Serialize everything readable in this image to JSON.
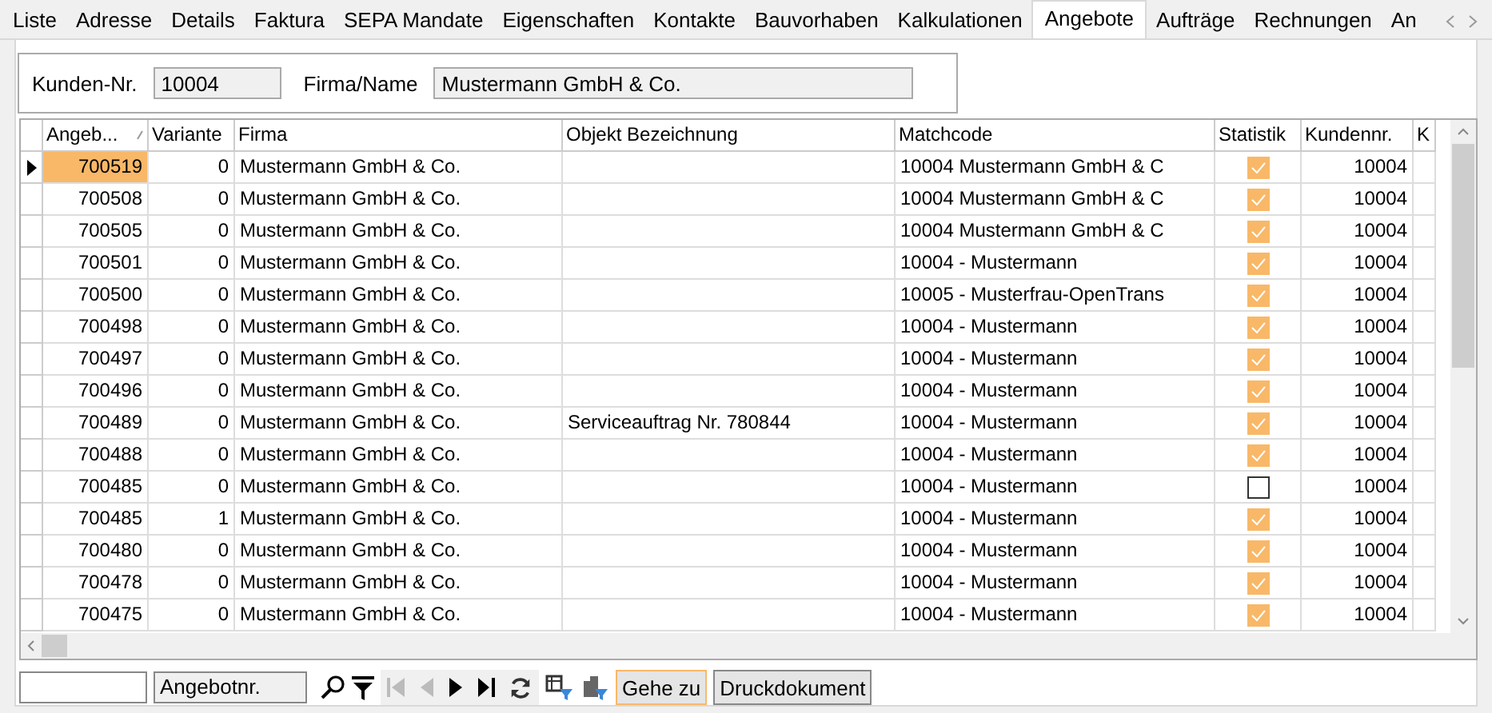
{
  "tabs": [
    {
      "label": "Liste",
      "selected": false
    },
    {
      "label": "Adresse",
      "selected": false
    },
    {
      "label": "Details",
      "selected": false
    },
    {
      "label": "Faktura",
      "selected": false
    },
    {
      "label": "SEPA Mandate",
      "selected": false
    },
    {
      "label": "Eigenschaften",
      "selected": false
    },
    {
      "label": "Kontakte",
      "selected": false
    },
    {
      "label": "Bauvorhaben",
      "selected": false
    },
    {
      "label": "Kalkulationen",
      "selected": false
    },
    {
      "label": "Angebote",
      "selected": true
    },
    {
      "label": "Aufträge",
      "selected": false
    },
    {
      "label": "Rechnungen",
      "selected": false
    },
    {
      "label": "An",
      "selected": false
    }
  ],
  "customer": {
    "number_label": "Kunden-Nr.",
    "number": "10004",
    "name_label": "Firma/Name",
    "name": "Mustermann GmbH & Co."
  },
  "table": {
    "columns": [
      "Angeb...",
      "Variante",
      "Firma",
      "Objekt Bezeichnung",
      "Matchcode",
      "Statistik",
      "Kundennr.",
      "K"
    ],
    "rows": [
      {
        "selected": true,
        "cells": [
          "700519",
          "0",
          "Mustermann GmbH & Co.",
          "",
          "10004 Mustermann GmbH & C"
        ],
        "statistik": true,
        "kundennr": "10004"
      },
      {
        "selected": false,
        "cells": [
          "700508",
          "0",
          "Mustermann GmbH & Co.",
          "",
          "10004 Mustermann GmbH & C"
        ],
        "statistik": true,
        "kundennr": "10004"
      },
      {
        "selected": false,
        "cells": [
          "700505",
          "0",
          "Mustermann GmbH & Co.",
          "",
          "10004 Mustermann GmbH & C"
        ],
        "statistik": true,
        "kundennr": "10004"
      },
      {
        "selected": false,
        "cells": [
          "700501",
          "0",
          "Mustermann GmbH & Co.",
          "",
          "10004 - Mustermann"
        ],
        "statistik": true,
        "kundennr": "10004"
      },
      {
        "selected": false,
        "cells": [
          "700500",
          "0",
          "Mustermann GmbH & Co.",
          "",
          "10005 - Musterfrau-OpenTrans"
        ],
        "statistik": true,
        "kundennr": "10004"
      },
      {
        "selected": false,
        "cells": [
          "700498",
          "0",
          "Mustermann GmbH & Co.",
          "",
          "10004 - Mustermann"
        ],
        "statistik": true,
        "kundennr": "10004"
      },
      {
        "selected": false,
        "cells": [
          "700497",
          "0",
          "Mustermann GmbH & Co.",
          "",
          "10004 - Mustermann"
        ],
        "statistik": true,
        "kundennr": "10004"
      },
      {
        "selected": false,
        "cells": [
          "700496",
          "0",
          "Mustermann GmbH & Co.",
          "",
          "10004 - Mustermann"
        ],
        "statistik": true,
        "kundennr": "10004"
      },
      {
        "selected": false,
        "cells": [
          "700489",
          "0",
          "Mustermann GmbH & Co.",
          "Serviceauftrag Nr. 780844",
          "10004 - Mustermann"
        ],
        "statistik": true,
        "kundennr": "10004"
      },
      {
        "selected": false,
        "cells": [
          "700488",
          "0",
          "Mustermann GmbH & Co.",
          "",
          "10004 - Mustermann"
        ],
        "statistik": true,
        "kundennr": "10004"
      },
      {
        "selected": false,
        "cells": [
          "700485",
          "0",
          "Mustermann GmbH & Co.",
          "",
          "10004 - Mustermann"
        ],
        "statistik": false,
        "kundennr": "10004"
      },
      {
        "selected": false,
        "cells": [
          "700485",
          "1",
          "Mustermann GmbH & Co.",
          "",
          "10004 - Mustermann"
        ],
        "statistik": true,
        "kundennr": "10004"
      },
      {
        "selected": false,
        "cells": [
          "700480",
          "0",
          "Mustermann GmbH & Co.",
          "",
          "10004 - Mustermann"
        ],
        "statistik": true,
        "kundennr": "10004"
      },
      {
        "selected": false,
        "cells": [
          "700478",
          "0",
          "Mustermann GmbH & Co.",
          "",
          "10004 - Mustermann"
        ],
        "statistik": true,
        "kundennr": "10004"
      },
      {
        "selected": false,
        "cells": [
          "700475",
          "0",
          "Mustermann GmbH & Co.",
          "",
          "10004 - Mustermann"
        ],
        "statistik": true,
        "kundennr": "10004"
      }
    ]
  },
  "toolbar": {
    "search_field": "Angebotnr.",
    "goto_button": "Gehe zu",
    "print_button": "Druckdokument"
  }
}
